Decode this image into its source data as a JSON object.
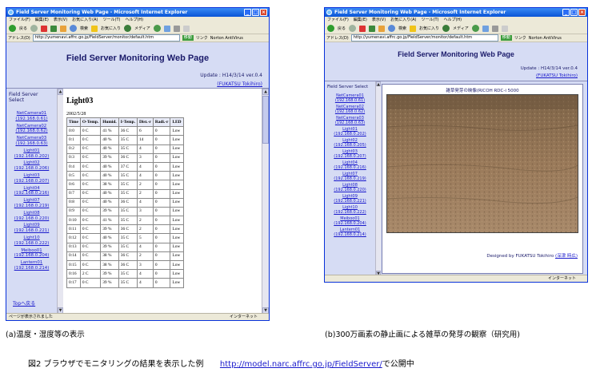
{
  "browser": {
    "title": "Field Server Monitoring Web Page - Microsoft Internet Explorer",
    "menu": [
      "ファイル(F)",
      "編集(E)",
      "表示(V)",
      "お気に入り(A)",
      "ツール(T)",
      "ヘルプ(H)"
    ],
    "toolbar": {
      "back": "戻る",
      "search": "検索",
      "favorites": "お気に入り",
      "media": "メディア"
    },
    "address_label": "アドレス(D)",
    "address_url": "http://yumenavi.affrc.go.jp/FieldServer/monitor/default.htm",
    "go_label": "移動",
    "links_label": "リンク",
    "norton_label": "Norton AntiVirus"
  },
  "page": {
    "title": "Field Server Monitoring Web Page",
    "update": "Update : H14/3/14  ver.0.4",
    "author": "(FUKATSU Tokihiro)"
  },
  "sidebar": {
    "select_title": "Field Server Select",
    "items_a": [
      [
        "NetCamera01",
        "(192.168.0.61)"
      ],
      [
        "NetCamera02",
        "(192.168.0.62)"
      ],
      [
        "NetCamera03",
        "(192.168.0.63)"
      ],
      [
        "Light01",
        "(192.168.0.202)"
      ],
      [
        "Light02",
        "(192.168.0.206)"
      ],
      [
        "Light03",
        "(192.168.0.207)"
      ],
      [
        "Light04",
        "(192.168.0.216)"
      ],
      [
        "Light07",
        "(192.168.0.219)"
      ],
      [
        "Light08",
        "(192.168.0.220)"
      ],
      [
        "Light09",
        "(192.168.0.221)"
      ],
      [
        "Light10",
        "(192.168.0.222)"
      ],
      [
        "Meiboo01",
        "(192.168.0.204)"
      ],
      [
        "Lantern01",
        "(192.168.0.214)"
      ]
    ],
    "items_b": [
      [
        "NetCamera01",
        "(192.168.0.61)"
      ],
      [
        "NetCamera02",
        "(192.168.0.62)"
      ],
      [
        "NetCamera03",
        "(192.168.0.63)"
      ],
      [
        "Light01",
        "(192.168.0.202)"
      ],
      [
        "Light02",
        "(192.168.0.205)"
      ],
      [
        "Light03",
        "(192.168.0.207)"
      ],
      [
        "Light04",
        "(192.168.0.216)"
      ],
      [
        "Light07",
        "(192.168.0.219)"
      ],
      [
        "Light08",
        "(192.168.0.220)"
      ],
      [
        "Light09",
        "(192.168.0.221)"
      ],
      [
        "Light10",
        "(192.168.0.222)"
      ],
      [
        "Meiboo01",
        "(192.168.0.204)"
      ],
      [
        "Lantern01",
        "(192.168.0.214)"
      ]
    ],
    "top_link": "Topへ戻る"
  },
  "panel_a": {
    "heading": "Light03",
    "date": "2002/5/28",
    "columns": [
      "Time",
      "O-Temp.",
      "Humid.",
      "I-Temp.",
      "Dist.-r",
      "Radi.-r",
      "LED"
    ],
    "rows": [
      [
        "0:0",
        "0 C",
        "41 %",
        "36 C",
        "6",
        "0",
        "Low"
      ],
      [
        "0:1",
        "0 C",
        "40 %",
        "35 C",
        "14",
        "0",
        "Low"
      ],
      [
        "0:2",
        "0 C",
        "40 %",
        "35 C",
        "4",
        "0",
        "Low"
      ],
      [
        "0:3",
        "0 C",
        "39 %",
        "36 C",
        "3",
        "0",
        "Low"
      ],
      [
        "0:4",
        "0 C",
        "40 %",
        "37 C",
        "4",
        "0",
        "Low"
      ],
      [
        "0:5",
        "0 C",
        "40 %",
        "35 C",
        "4",
        "0",
        "Low"
      ],
      [
        "0:6",
        "0 C",
        "38 %",
        "35 C",
        "2",
        "0",
        "Low"
      ],
      [
        "0:7",
        "0 C",
        "40 %",
        "35 C",
        "2",
        "0",
        "Low"
      ],
      [
        "0:8",
        "0 C",
        "40 %",
        "36 C",
        "4",
        "0",
        "Low"
      ],
      [
        "0:9",
        "0 C",
        "39 %",
        "35 C",
        "3",
        "0",
        "Low"
      ],
      [
        "0:10",
        "0 C",
        "41 %",
        "35 C",
        "2",
        "0",
        "Low"
      ],
      [
        "0:11",
        "0 C",
        "39 %",
        "36 C",
        "2",
        "0",
        "Low"
      ],
      [
        "0:12",
        "0 C",
        "40 %",
        "35 C",
        "5",
        "0",
        "Low"
      ],
      [
        "0:13",
        "0 C",
        "39 %",
        "35 C",
        "4",
        "0",
        "Low"
      ],
      [
        "0:14",
        "0 C",
        "38 %",
        "36 C",
        "2",
        "0",
        "Low"
      ],
      [
        "0:15",
        "0 C",
        "38 %",
        "36 C",
        "3",
        "0",
        "Low"
      ],
      [
        "0:16",
        "2 C",
        "39 %",
        "35 C",
        "4",
        "0",
        "Low"
      ],
      [
        "0:17",
        "0 C",
        "39 %",
        "35 C",
        "4",
        "0",
        "Low"
      ]
    ]
  },
  "panel_b": {
    "image_title": "雑草発芽の映像(RICOH RDC-i 5000",
    "designed_by": "Designed by FUKATSU Tokihiro",
    "contact": "(深津 時広)"
  },
  "status": {
    "left_a": "ページが表示されました",
    "zone": "インターネット"
  },
  "captions": {
    "a": "(a)温度・湿度等の表示",
    "b": "(b)300万画素の静止画による雑草の発芽の観察（研究用)",
    "figure": "図2  ブラウザでモニタリングの結果を表示した例",
    "url": "http://model.narc.affrc.go.jp/FieldServer/",
    "url_suffix": "で公開中"
  },
  "colors": {
    "page_bg": "#d6dcf4",
    "title_bar": "#0a54d6",
    "link": "#1a1acc",
    "soil": "#9a7a5a"
  }
}
